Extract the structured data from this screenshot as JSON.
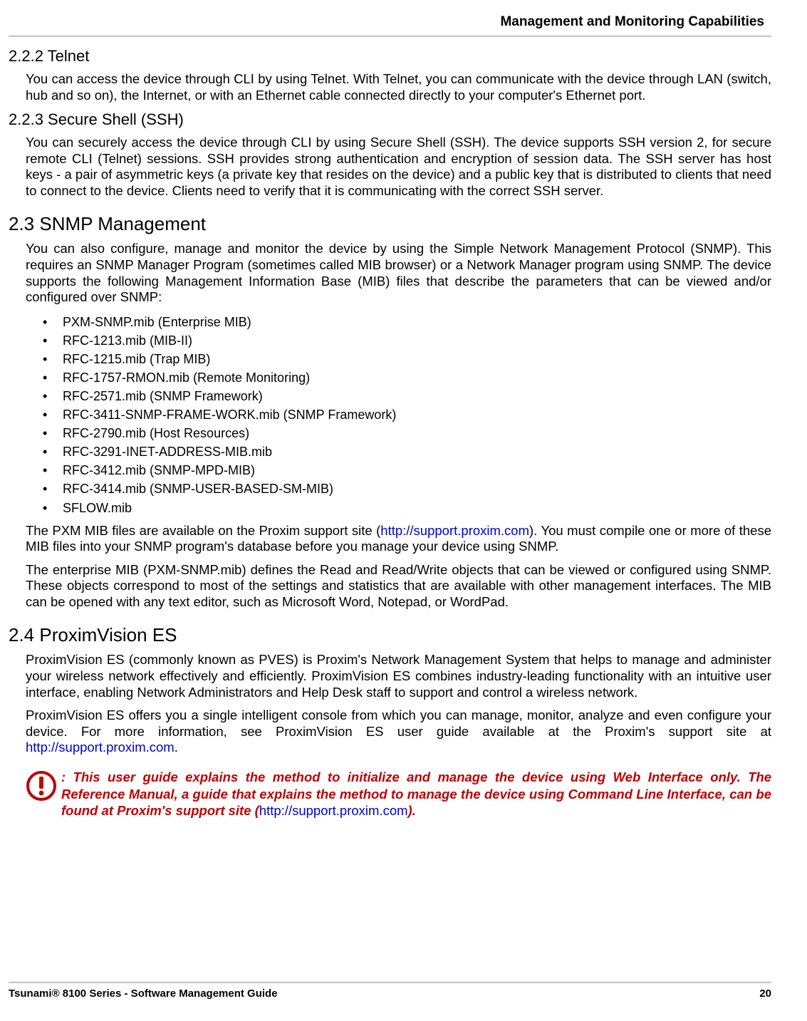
{
  "header": {
    "title": "Management and Monitoring Capabilities"
  },
  "s222": {
    "heading": "2.2.2 Telnet",
    "p1": "You can access the device through CLI by using Telnet. With Telnet, you can communicate with the device through LAN (switch, hub and so on), the Internet, or with an Ethernet cable connected directly to your computer's Ethernet port."
  },
  "s223": {
    "heading": "2.2.3 Secure Shell (SSH)",
    "p1": "You can securely access the device through CLI by using Secure Shell (SSH). The device supports SSH version 2, for secure remote CLI (Telnet) sessions. SSH provides strong authentication and encryption of session data. The SSH server has host keys - a pair of asymmetric keys (a private key that resides on the device) and a public key that is distributed to clients that need to connect to the device. Clients need to verify that it is communicating with the correct SSH server."
  },
  "s23": {
    "heading": "2.3 SNMP Management",
    "p1": "You can also configure, manage and monitor the device by using the Simple Network Management Protocol (SNMP). This requires an SNMP Manager Program (sometimes called MIB browser) or a Network Manager program using SNMP. The device supports the following Management Information Base (MIB) files that describe the parameters that can be viewed and/or configured over SNMP:",
    "mibs": [
      "PXM-SNMP.mib (Enterprise MIB)",
      "RFC-1213.mib (MIB-II)",
      "RFC-1215.mib (Trap MIB)",
      "RFC-1757-RMON.mib (Remote Monitoring)",
      "RFC-2571.mib (SNMP Framework)",
      "RFC-3411-SNMP-FRAME-WORK.mib (SNMP Framework)",
      "RFC-2790.mib (Host Resources)",
      "RFC-3291-INET-ADDRESS-MIB.mib",
      "RFC-3412.mib (SNMP-MPD-MIB)",
      "RFC-3414.mib (SNMP-USER-BASED-SM-MIB)",
      "SFLOW.mib"
    ],
    "p2a": "The PXM MIB files are available on the Proxim support site (",
    "p2link": "http://support.proxim.com",
    "p2b": "). You must compile one or more of these MIB files into your SNMP program's database before you manage your device using SNMP.",
    "p3": "The enterprise MIB (PXM-SNMP.mib) defines the Read and Read/Write objects that can be viewed or configured using SNMP. These objects correspond to most of the settings and statistics that are available with other management interfaces. The MIB can be opened with any text editor, such as Microsoft Word, Notepad, or WordPad."
  },
  "s24": {
    "heading": "2.4 ProximVision ES",
    "p1": "ProximVision ES (commonly known as PVES) is Proxim's Network Management System that helps to manage and administer your wireless network effectively and efficiently. ProximVision ES combines industry-leading functionality with an intuitive user interface, enabling Network Administrators and Help Desk staff to support and control a wireless network.",
    "p2a": "ProximVision ES offers you a single intelligent console from which you can manage, monitor, analyze and even configure your device. For more information, see ProximVision ES user guide available at the Proxim's support site at ",
    "p2link": "http://support.proxim.com",
    "p2b": "."
  },
  "note": {
    "t1": ": This user guide explains the method to initialize and manage the device using Web Interface only. The Reference Manual, a guide that explains the method to manage the device using Command Line Interface, can be found at Proxim's support site (",
    "link": "http://support.proxim.com",
    "t2": ")."
  },
  "footer": {
    "left": "Tsunami® 8100 Series - Software Management Guide",
    "right": "20"
  }
}
